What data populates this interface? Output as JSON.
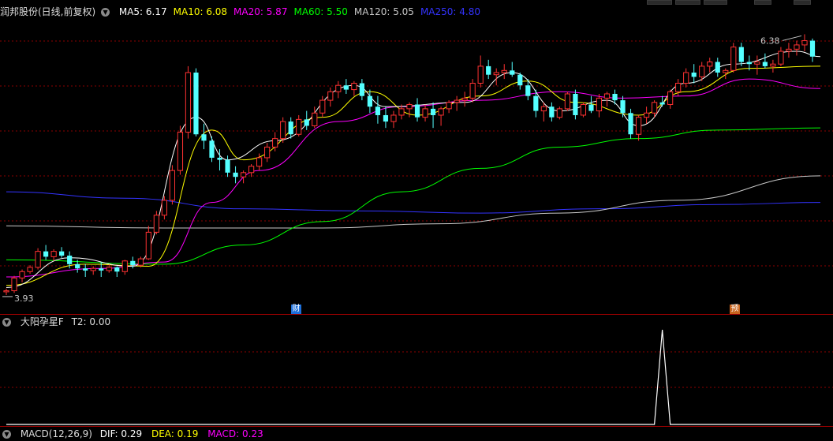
{
  "header": {
    "stock_title": "润邦股份(日线,前复权)",
    "ma_items": [
      {
        "label": "MA5: 6.17",
        "color": "#ffffff"
      },
      {
        "label": "MA10: 6.08",
        "color": "#ffff00"
      },
      {
        "label": "MA20: 5.87",
        "color": "#ff00ff"
      },
      {
        "label": "MA60: 5.50",
        "color": "#00ff00"
      },
      {
        "label": "MA120: 5.05",
        "color": "#c8c8c8"
      },
      {
        "label": "MA250: 4.80",
        "color": "#3333ff"
      }
    ]
  },
  "price_annotations": {
    "high": "6.38",
    "low": "3.93"
  },
  "event_tags": [
    {
      "text": "财",
      "color": "#1e6fd9"
    },
    {
      "text": "预",
      "color": "#c8641e"
    }
  ],
  "indicator": {
    "title": "大阳孕星F",
    "value_label": "T2: 0.00"
  },
  "macd": {
    "name": "MACD(12,26,9)",
    "dif": "DIF: 0.29",
    "dea": "DEA: 0.19",
    "macd": "MACD: 0.23"
  },
  "colors": {
    "up": "#ff3232",
    "down": "#54ffff",
    "grid": "#8b0000",
    "ma5": "#ffffff",
    "ma10": "#ffff00",
    "ma20": "#ff00ff",
    "ma60": "#00ff00",
    "ma120": "#c8c8c8",
    "ma250": "#3333ff"
  },
  "chart_data": [
    {
      "type": "candlestick",
      "title": "润邦股份(日线,前复权)",
      "price_range": [
        3.9,
        6.45
      ],
      "candles_ohlc": [
        [
          3.96,
          3.99,
          3.93,
          3.97
        ],
        [
          3.97,
          4.11,
          3.95,
          4.09
        ],
        [
          4.09,
          4.17,
          4.05,
          4.15
        ],
        [
          4.15,
          4.21,
          4.13,
          4.19
        ],
        [
          4.19,
          4.37,
          4.17,
          4.34
        ],
        [
          4.34,
          4.4,
          4.26,
          4.29
        ],
        [
          4.29,
          4.36,
          4.25,
          4.34
        ],
        [
          4.34,
          4.38,
          4.28,
          4.3
        ],
        [
          4.3,
          4.34,
          4.18,
          4.22
        ],
        [
          4.22,
          4.26,
          4.14,
          4.18
        ],
        [
          4.18,
          4.22,
          4.1,
          4.16
        ],
        [
          4.16,
          4.2,
          4.12,
          4.18
        ],
        [
          4.18,
          4.24,
          4.1,
          4.16
        ],
        [
          4.16,
          4.22,
          4.14,
          4.19
        ],
        [
          4.19,
          4.2,
          4.1,
          4.15
        ],
        [
          4.15,
          4.26,
          4.12,
          4.25
        ],
        [
          4.25,
          4.29,
          4.18,
          4.21
        ],
        [
          4.21,
          4.29,
          4.19,
          4.27
        ],
        [
          4.27,
          4.58,
          4.26,
          4.52
        ],
        [
          4.52,
          4.72,
          4.5,
          4.68
        ],
        [
          4.68,
          4.86,
          4.64,
          4.82
        ],
        [
          4.82,
          5.15,
          4.78,
          5.1
        ],
        [
          5.1,
          5.52,
          5.06,
          5.46
        ],
        [
          5.46,
          6.08,
          5.4,
          6.02
        ],
        [
          6.02,
          6.06,
          5.42,
          5.44
        ],
        [
          5.44,
          5.54,
          5.3,
          5.38
        ],
        [
          5.38,
          5.42,
          5.18,
          5.22
        ],
        [
          5.22,
          5.3,
          5.1,
          5.2
        ],
        [
          5.2,
          5.24,
          5.04,
          5.08
        ],
        [
          5.08,
          5.14,
          4.98,
          5.04
        ],
        [
          5.04,
          5.1,
          4.98,
          5.08
        ],
        [
          5.08,
          5.16,
          5.04,
          5.14
        ],
        [
          5.14,
          5.26,
          5.1,
          5.22
        ],
        [
          5.22,
          5.36,
          5.18,
          5.32
        ],
        [
          5.32,
          5.46,
          5.28,
          5.4
        ],
        [
          5.4,
          5.6,
          5.36,
          5.56
        ],
        [
          5.56,
          5.6,
          5.4,
          5.44
        ],
        [
          5.44,
          5.62,
          5.42,
          5.58
        ],
        [
          5.58,
          5.66,
          5.48,
          5.52
        ],
        [
          5.52,
          5.7,
          5.5,
          5.64
        ],
        [
          5.64,
          5.8,
          5.6,
          5.76
        ],
        [
          5.76,
          5.88,
          5.7,
          5.84
        ],
        [
          5.84,
          5.94,
          5.78,
          5.9
        ],
        [
          5.9,
          5.96,
          5.82,
          5.86
        ],
        [
          5.86,
          5.94,
          5.8,
          5.92
        ],
        [
          5.92,
          5.96,
          5.76,
          5.8
        ],
        [
          5.8,
          5.86,
          5.64,
          5.7
        ],
        [
          5.7,
          5.8,
          5.54,
          5.62
        ],
        [
          5.62,
          5.7,
          5.5,
          5.56
        ],
        [
          5.56,
          5.66,
          5.5,
          5.62
        ],
        [
          5.62,
          5.72,
          5.58,
          5.68
        ],
        [
          5.68,
          5.74,
          5.6,
          5.72
        ],
        [
          5.72,
          5.78,
          5.56,
          5.6
        ],
        [
          5.6,
          5.72,
          5.56,
          5.68
        ],
        [
          5.68,
          5.74,
          5.5,
          5.62
        ],
        [
          5.62,
          5.7,
          5.52,
          5.68
        ],
        [
          5.68,
          5.76,
          5.64,
          5.74
        ],
        [
          5.74,
          5.8,
          5.66,
          5.76
        ],
        [
          5.76,
          5.84,
          5.7,
          5.78
        ],
        [
          5.78,
          5.96,
          5.74,
          5.92
        ],
        [
          5.92,
          6.18,
          5.88,
          6.08
        ],
        [
          6.08,
          6.14,
          5.96,
          6.0
        ],
        [
          6.0,
          6.06,
          5.9,
          6.02
        ],
        [
          6.02,
          6.1,
          5.96,
          6.04
        ],
        [
          6.04,
          6.12,
          5.98,
          6.0
        ],
        [
          6.0,
          6.02,
          5.86,
          5.9
        ],
        [
          5.9,
          5.96,
          5.76,
          5.8
        ],
        [
          5.8,
          5.86,
          5.6,
          5.66
        ],
        [
          5.66,
          5.74,
          5.56,
          5.7
        ],
        [
          5.7,
          5.74,
          5.56,
          5.6
        ],
        [
          5.6,
          5.7,
          5.58,
          5.68
        ],
        [
          5.68,
          5.84,
          5.66,
          5.82
        ],
        [
          5.82,
          5.86,
          5.58,
          5.62
        ],
        [
          5.62,
          5.74,
          5.6,
          5.72
        ],
        [
          5.72,
          5.8,
          5.64,
          5.66
        ],
        [
          5.66,
          5.82,
          5.6,
          5.78
        ],
        [
          5.78,
          5.84,
          5.7,
          5.82
        ],
        [
          5.82,
          5.86,
          5.72,
          5.76
        ],
        [
          5.76,
          5.8,
          5.6,
          5.64
        ],
        [
          5.64,
          5.68,
          5.4,
          5.44
        ],
        [
          5.44,
          5.62,
          5.38,
          5.6
        ],
        [
          5.6,
          5.7,
          5.54,
          5.64
        ],
        [
          5.64,
          5.76,
          5.6,
          5.74
        ],
        [
          5.74,
          5.8,
          5.7,
          5.72
        ],
        [
          5.72,
          5.86,
          5.68,
          5.84
        ],
        [
          5.84,
          5.96,
          5.8,
          5.92
        ],
        [
          5.92,
          6.06,
          5.88,
          6.02
        ],
        [
          6.02,
          6.1,
          5.92,
          5.98
        ],
        [
          5.98,
          6.12,
          5.94,
          6.08
        ],
        [
          6.08,
          6.16,
          6.02,
          6.12
        ],
        [
          6.12,
          6.16,
          5.98,
          6.02
        ],
        [
          6.02,
          6.06,
          5.96,
          6.04
        ],
        [
          6.04,
          6.3,
          6.02,
          6.26
        ],
        [
          6.26,
          6.3,
          6.08,
          6.12
        ],
        [
          6.12,
          6.18,
          6.04,
          6.1
        ],
        [
          6.1,
          6.18,
          6.0,
          6.12
        ],
        [
          6.12,
          6.2,
          6.06,
          6.08
        ],
        [
          6.08,
          6.14,
          6.02,
          6.1
        ],
        [
          6.1,
          6.26,
          6.08,
          6.22
        ],
        [
          6.22,
          6.3,
          6.16,
          6.24
        ],
        [
          6.24,
          6.32,
          6.18,
          6.28
        ],
        [
          6.28,
          6.38,
          6.22,
          6.32
        ],
        [
          6.32,
          6.34,
          6.12,
          6.17
        ]
      ],
      "moving_averages": [
        {
          "name": "MA5",
          "values": [
            [
              0,
              4.0
            ],
            [
              8,
              4.28
            ],
            [
              16,
              4.2
            ],
            [
              24,
              5.6
            ],
            [
              28,
              5.2
            ],
            [
              34,
              5.38
            ],
            [
              44,
              5.9
            ],
            [
              48,
              5.7
            ],
            [
              58,
              5.74
            ],
            [
              64,
              6.02
            ],
            [
              70,
              5.66
            ],
            [
              76,
              5.76
            ],
            [
              80,
              5.52
            ],
            [
              86,
              5.92
            ],
            [
              92,
              6.1
            ],
            [
              100,
              6.22
            ],
            [
              103,
              6.17
            ]
          ]
        },
        {
          "name": "MA10",
          "values": [
            [
              0,
              4.02
            ],
            [
              10,
              4.22
            ],
            [
              18,
              4.2
            ],
            [
              26,
              5.48
            ],
            [
              30,
              5.2
            ],
            [
              40,
              5.6
            ],
            [
              46,
              5.84
            ],
            [
              52,
              5.62
            ],
            [
              60,
              5.8
            ],
            [
              66,
              5.94
            ],
            [
              72,
              5.74
            ],
            [
              80,
              5.62
            ],
            [
              86,
              5.84
            ],
            [
              94,
              6.06
            ],
            [
              103,
              6.08
            ]
          ]
        },
        {
          "name": "MA20",
          "values": [
            [
              0,
              4.1
            ],
            [
              12,
              4.18
            ],
            [
              20,
              4.24
            ],
            [
              26,
              4.8
            ],
            [
              32,
              5.1
            ],
            [
              42,
              5.56
            ],
            [
              50,
              5.7
            ],
            [
              60,
              5.76
            ],
            [
              70,
              5.84
            ],
            [
              78,
              5.78
            ],
            [
              86,
              5.8
            ],
            [
              94,
              5.96
            ],
            [
              103,
              5.87
            ]
          ]
        },
        {
          "name": "MA60",
          "values": [
            [
              0,
              4.26
            ],
            [
              20,
              4.22
            ],
            [
              30,
              4.4
            ],
            [
              40,
              4.62
            ],
            [
              50,
              4.9
            ],
            [
              60,
              5.12
            ],
            [
              70,
              5.32
            ],
            [
              80,
              5.4
            ],
            [
              90,
              5.48
            ],
            [
              103,
              5.5
            ]
          ]
        },
        {
          "name": "MA120",
          "values": [
            [
              0,
              4.58
            ],
            [
              20,
              4.56
            ],
            [
              40,
              4.56
            ],
            [
              55,
              4.6
            ],
            [
              70,
              4.7
            ],
            [
              85,
              4.82
            ],
            [
              103,
              5.05
            ]
          ]
        },
        {
          "name": "MA250",
          "values": [
            [
              0,
              4.9
            ],
            [
              15,
              4.84
            ],
            [
              30,
              4.74
            ],
            [
              45,
              4.72
            ],
            [
              60,
              4.7
            ],
            [
              75,
              4.74
            ],
            [
              90,
              4.78
            ],
            [
              103,
              4.8
            ]
          ]
        }
      ]
    },
    {
      "type": "line",
      "title": "大阳孕星F",
      "series": [
        {
          "name": "T2",
          "values": [
            [
              0,
              0
            ],
            [
              82,
              0
            ],
            [
              83,
              1
            ],
            [
              84,
              0
            ],
            [
              103,
              0
            ]
          ]
        }
      ]
    }
  ]
}
